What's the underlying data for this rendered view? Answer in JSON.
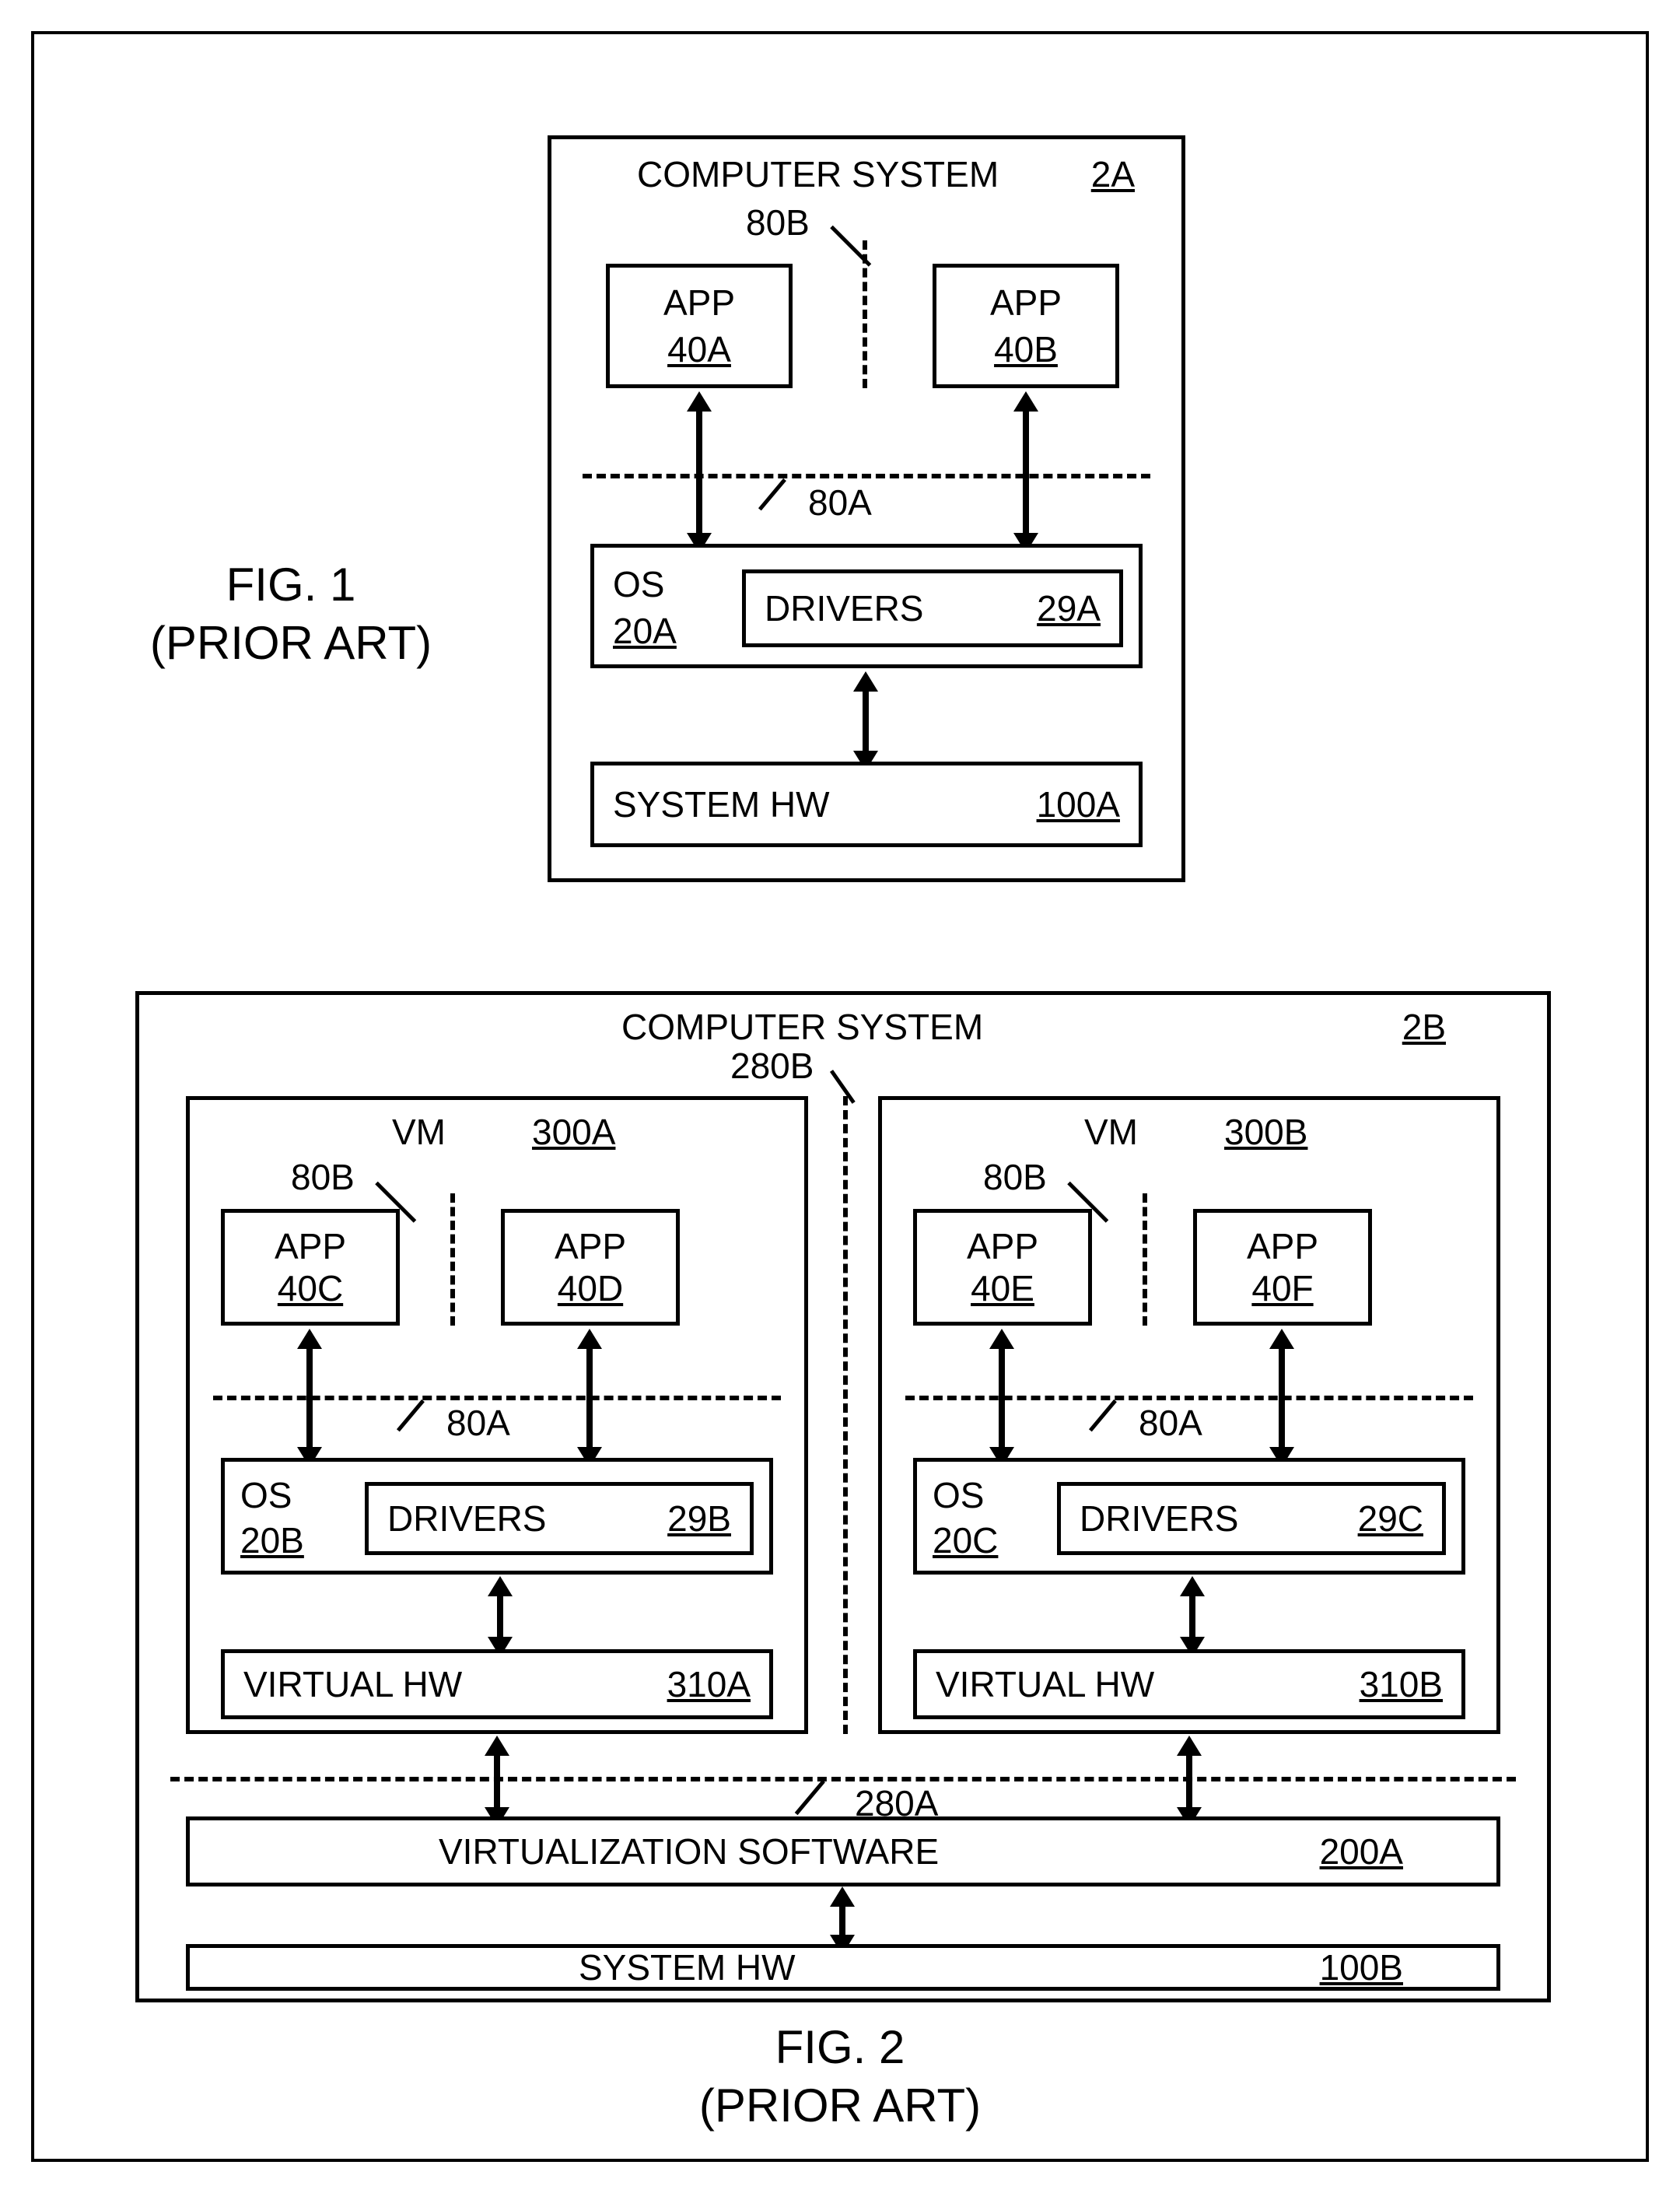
{
  "fig1": {
    "caption_line1": "FIG. 1",
    "caption_line2": "(PRIOR ART)",
    "title": "COMPUTER SYSTEM",
    "title_ref": "2A",
    "app1": "APP",
    "app1_ref": "40A",
    "app2": "APP",
    "app2_ref": "40B",
    "iface_80b": "80B",
    "iface_80a": "80A",
    "os": "OS",
    "os_ref": "20A",
    "drivers": "DRIVERS",
    "drivers_ref": "29A",
    "hw": "SYSTEM HW",
    "hw_ref": "100A"
  },
  "fig2": {
    "caption_line1": "FIG. 2",
    "caption_line2": "(PRIOR ART)",
    "title": "COMPUTER SYSTEM",
    "title_ref": "2B",
    "iface_280b": "280B",
    "iface_280a": "280A",
    "virt_sw": "VIRTUALIZATION SOFTWARE",
    "virt_sw_ref": "200A",
    "hw": "SYSTEM HW",
    "hw_ref": "100B",
    "vmA": {
      "title": "VM",
      "ref": "300A",
      "iface_80b": "80B",
      "iface_80a": "80A",
      "app1": "APP",
      "app1_ref": "40C",
      "app2": "APP",
      "app2_ref": "40D",
      "os": "OS",
      "os_ref": "20B",
      "drivers": "DRIVERS",
      "drivers_ref": "29B",
      "vhw": "VIRTUAL HW",
      "vhw_ref": "310A"
    },
    "vmB": {
      "title": "VM",
      "ref": "300B",
      "iface_80b": "80B",
      "iface_80a": "80A",
      "app1": "APP",
      "app1_ref": "40E",
      "app2": "APP",
      "app2_ref": "40F",
      "os": "OS",
      "os_ref": "20C",
      "drivers": "DRIVERS",
      "drivers_ref": "29C",
      "vhw": "VIRTUAL HW",
      "vhw_ref": "310B"
    }
  }
}
